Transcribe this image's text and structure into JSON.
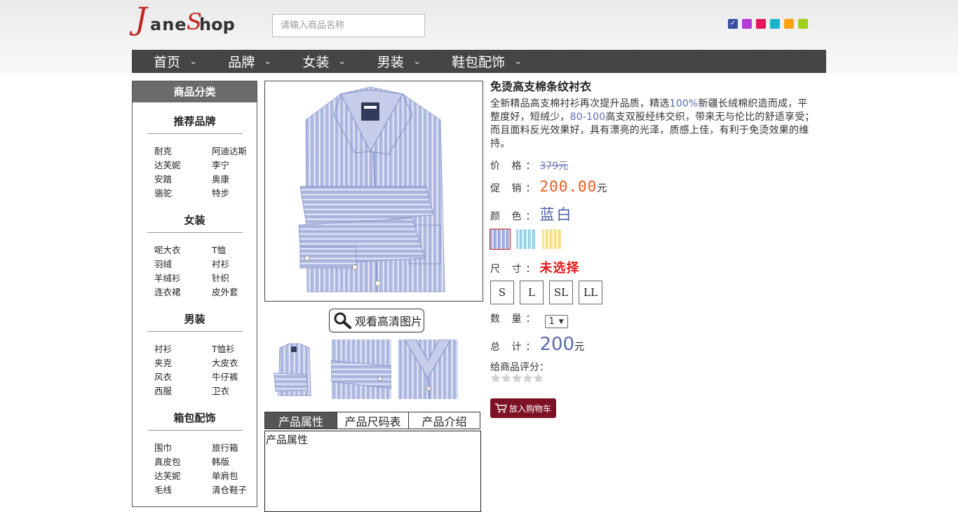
{
  "logo": {
    "j": "J",
    "ane": "ane",
    "s": "S",
    "hop": "hop"
  },
  "search": {
    "placeholder": "请输入商品名称"
  },
  "theme_colors": [
    "#3a4fa0",
    "#b43bd6",
    "#e0195c",
    "#17b6c9",
    "#ffa312",
    "#9ecf1a"
  ],
  "nav": [
    {
      "label": "首页"
    },
    {
      "label": "品牌"
    },
    {
      "label": "女装"
    },
    {
      "label": "男装"
    },
    {
      "label": "鞋包配饰"
    }
  ],
  "sidebar": {
    "header": "商品分类",
    "categories": [
      {
        "title": "推荐品牌",
        "items": [
          "耐克",
          "阿迪达斯",
          "达芙妮",
          "李宁",
          "安踏",
          "奥康",
          "骆驼",
          "特步"
        ]
      },
      {
        "title": "女装",
        "items": [
          "呢大衣",
          "T恤",
          "羽绒",
          "衬衫",
          "羊绒衫",
          "针织",
          "连衣裙",
          "皮外套"
        ]
      },
      {
        "title": "男装",
        "items": [
          "衬衫",
          "T恤衫",
          "夹克",
          "大皮衣",
          "风衣",
          "牛仔裤",
          "西服",
          "卫衣"
        ]
      },
      {
        "title": "箱包配饰",
        "items": [
          "围巾",
          "旅行箱",
          "真皮包",
          "韩版",
          "达芙妮",
          "单肩包",
          "毛线",
          "清仓鞋子"
        ]
      }
    ]
  },
  "gallery": {
    "hd_label": "观看高清图片"
  },
  "tabs": [
    {
      "label": "产品属性",
      "active": true
    },
    {
      "label": "产品尺码表",
      "active": false
    },
    {
      "label": "产品介绍",
      "active": false
    }
  ],
  "tab_content": "产品属性",
  "product": {
    "title": "免烫高支棉条纹衬衣",
    "desc_1": "全新精品高支棉衬衫再次提升品质，精选",
    "desc_hl1": "100%",
    "desc_2": "新疆长绒棉织造而成，平整度好，短绒少，",
    "desc_hl2": "80-100",
    "desc_3": "高支双股经纬交织，带来无与伦比的舒适享受；而且面料反光效果好，具有漂亮的光泽，质感上佳，有利于免烫效果的维持。",
    "price_label": "价 格：",
    "price_orig": "379元",
    "promo_label": "促 销：",
    "promo_price": "200.00",
    "promo_unit": "元",
    "color_label": "颜 色：",
    "color_value": "蓝白",
    "size_label": "尺 寸：",
    "size_value": "未选择",
    "sizes": [
      "S",
      "L",
      "SL",
      "LL"
    ],
    "qty_label": "数 量：",
    "qty_value": "1",
    "total_label": "总 计：",
    "total_value": "200",
    "total_unit": "元",
    "rating_label": "给商品评分：",
    "rating": 0,
    "rating_max": 5,
    "cart_label": "放入购物车"
  }
}
